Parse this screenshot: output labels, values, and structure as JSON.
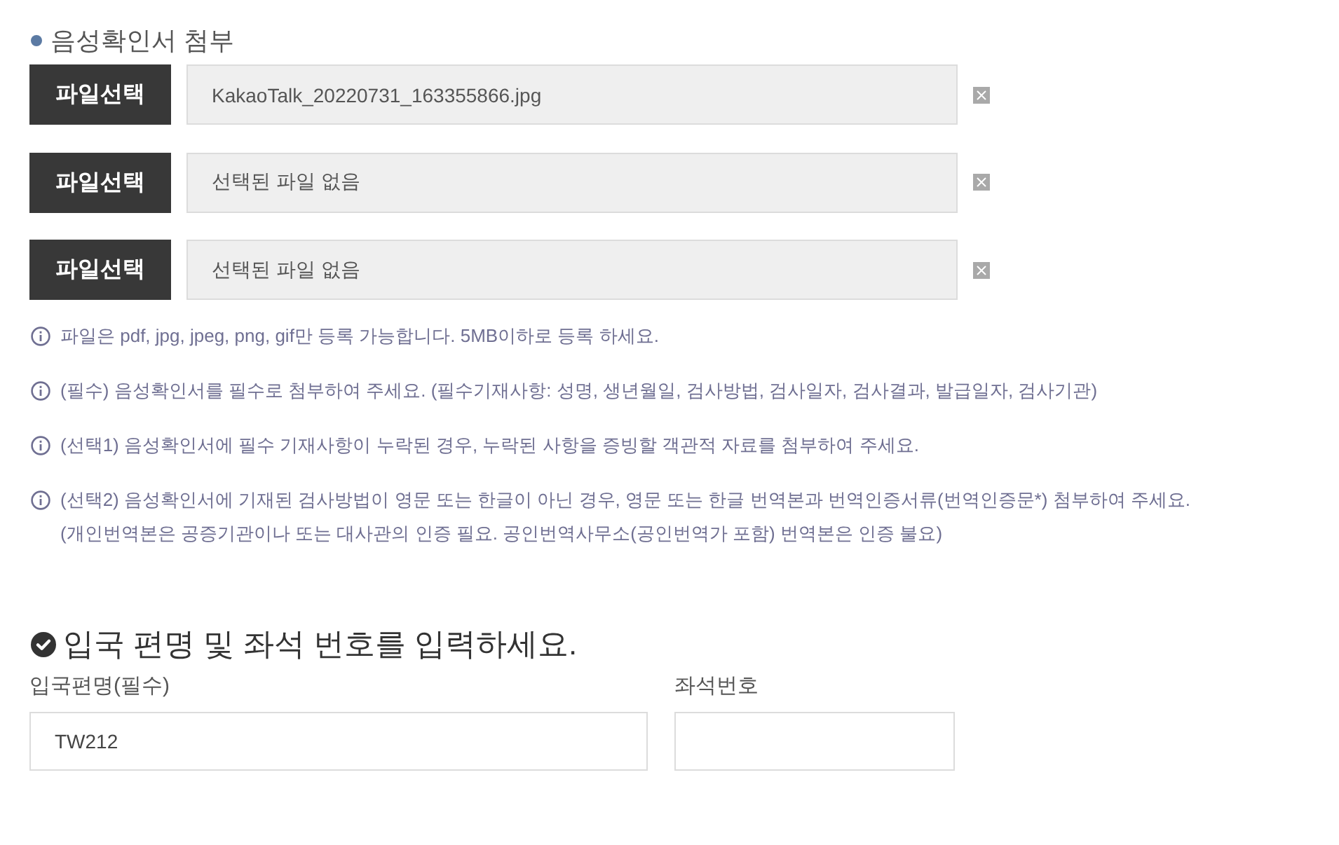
{
  "section_title": "음성확인서 첨부",
  "file_rows": [
    {
      "button": "파일선택",
      "file_name": "KakaoTalk_20220731_163355866.jpg"
    },
    {
      "button": "파일선택",
      "file_name": "선택된 파일 없음"
    },
    {
      "button": "파일선택",
      "file_name": "선택된 파일 없음"
    }
  ],
  "notes": [
    {
      "lines": [
        "파일은 pdf, jpg, jpeg, png, gif만 등록 가능합니다. 5MB이하로 등록 하세요."
      ]
    },
    {
      "lines": [
        "(필수) 음성확인서를 필수로 첨부하여 주세요. (필수기재사항: 성명, 생년월일, 검사방법, 검사일자, 검사결과, 발급일자, 검사기관)"
      ]
    },
    {
      "lines": [
        "(선택1) 음성확인서에 필수 기재사항이 누락된 경우, 누락된 사항을 증빙할 객관적 자료를 첨부하여 주세요."
      ]
    },
    {
      "lines": [
        "(선택2) 음성확인서에 기재된 검사방법이 영문 또는 한글이 아닌 경우, 영문 또는 한글 번역본과 번역인증서류(번역인증문*) 첨부하여 주세요.",
        "(개인번역본은 공증기관이나 또는 대사관의 인증 필요. 공인번역사무소(공인번역가 포함) 번역본은 인증 불요)"
      ]
    }
  ],
  "flight_section": {
    "heading": "입국 편명 및 좌석 번호를 입력하세요.",
    "fields": [
      {
        "label": "입국편명(필수)",
        "value": "TW212"
      },
      {
        "label": "좌석번호"
      }
    ]
  }
}
